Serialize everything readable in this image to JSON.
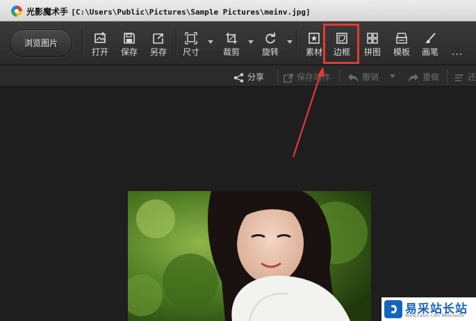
{
  "window": {
    "app_name": "光影魔术手",
    "file_path": "[C:\\Users\\Public\\Pictures\\Sample Pictures\\meinv.jpg]"
  },
  "toolbar": {
    "browse_label": "浏览图片",
    "tools": [
      {
        "label": "打开",
        "icon": "open-icon"
      },
      {
        "label": "保存",
        "icon": "save-icon"
      },
      {
        "label": "另存",
        "icon": "save-as-icon"
      },
      {
        "label": "尺寸",
        "icon": "resize-icon"
      },
      {
        "label": "裁剪",
        "icon": "crop-icon"
      },
      {
        "label": "旋转",
        "icon": "rotate-icon"
      },
      {
        "label": "素材",
        "icon": "material-icon"
      },
      {
        "label": "边框",
        "icon": "border-icon"
      },
      {
        "label": "拼图",
        "icon": "collage-icon"
      },
      {
        "label": "模板",
        "icon": "template-icon"
      },
      {
        "label": "画笔",
        "icon": "brush-icon"
      }
    ],
    "more_label": "···"
  },
  "subbar": {
    "share": "分享",
    "save_action": "保存动作",
    "undo": "撤销",
    "redo": "重做",
    "overflow": "还"
  },
  "watermark": {
    "text": "易采站长站",
    "url": "Www.Easck.Com Webmaster"
  },
  "colors": {
    "highlight": "#e53935",
    "background": "#1e1e1e",
    "watermark_blue": "#1565c0"
  }
}
